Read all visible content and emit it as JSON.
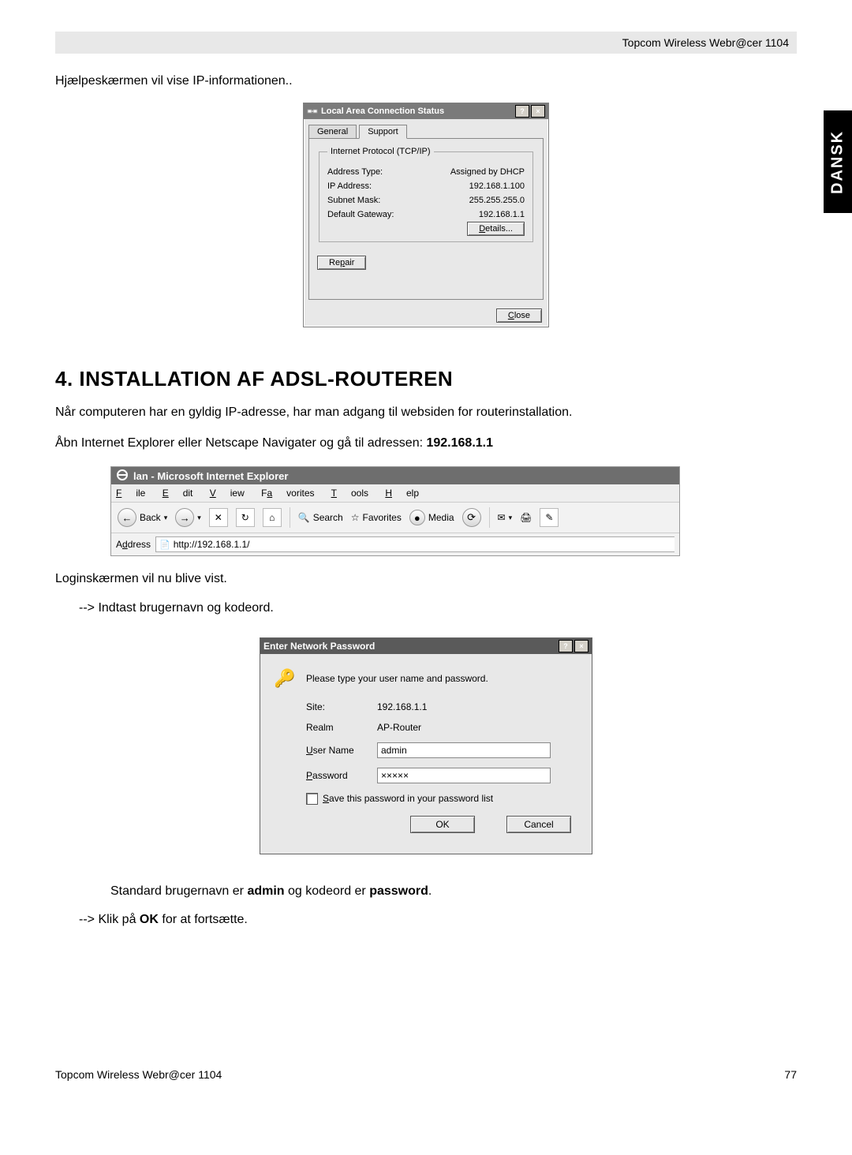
{
  "header_product": "Topcom Wireless Webr@cer 1104",
  "side_tab": "DANSK",
  "intro_text": "Hjælpeskærmen vil vise IP-informationen..",
  "lacs": {
    "title": "Local Area Connection Status",
    "tabs": {
      "general": "General",
      "support": "Support"
    },
    "group_legend": "Internet Protocol (TCP/IP)",
    "rows": {
      "addr_type_label": "Address Type:",
      "addr_type_val": "Assigned by DHCP",
      "ip_label": "IP Address:",
      "ip_val": "192.168.1.100",
      "subnet_label": "Subnet Mask:",
      "subnet_val": "255.255.255.0",
      "gateway_label": "Default Gateway:",
      "gateway_val": "192.168.1.1"
    },
    "details_btn": "Details...",
    "repair_btn": "Repair",
    "close_btn": "Close"
  },
  "section_heading": "4. INSTALLATION AF ADSL-ROUTEREN",
  "para1": "Når computeren har en gyldig IP-adresse, har man adgang til websiden for routerinstallation.",
  "para2_pre": "Åbn Internet Explorer eller Netscape Navigater og gå til adressen: ",
  "para2_ip": "192.168.1.1",
  "ie": {
    "title": "lan - Microsoft Internet Explorer",
    "menu": {
      "file": "File",
      "edit": "Edit",
      "view": "View",
      "favorites": "Favorites",
      "tools": "Tools",
      "help": "Help"
    },
    "toolbar": {
      "back": "Back",
      "search": "Search",
      "favorites": "Favorites",
      "media": "Media"
    },
    "address_label": "Address",
    "url": "http://192.168.1.1/"
  },
  "para3": "Loginskærmen vil nu blive vist.",
  "bullet1": "-->  Indtast brugernavn og kodeord.",
  "enp": {
    "title": "Enter Network Password",
    "prompt": "Please type your user name and password.",
    "site_label": "Site:",
    "site_val": "192.168.1.1",
    "realm_label": "Realm",
    "realm_val": "AP-Router",
    "user_label": "User Name",
    "user_val": "admin",
    "pass_label": "Password",
    "pass_val": "×××××",
    "save_label": "Save this password in your password list",
    "ok": "OK",
    "cancel": "Cancel"
  },
  "para4_pre": "Standard brugernavn er ",
  "para4_admin": "admin",
  "para4_mid": " og kodeord er ",
  "para4_password": "password",
  "para4_post": ".",
  "bullet2_pre": "-->  Klik på ",
  "bullet2_ok": "OK",
  "bullet2_post": " for at fortsætte.",
  "footer_product": "Topcom Wireless Webr@cer 1104",
  "page_number": "77"
}
